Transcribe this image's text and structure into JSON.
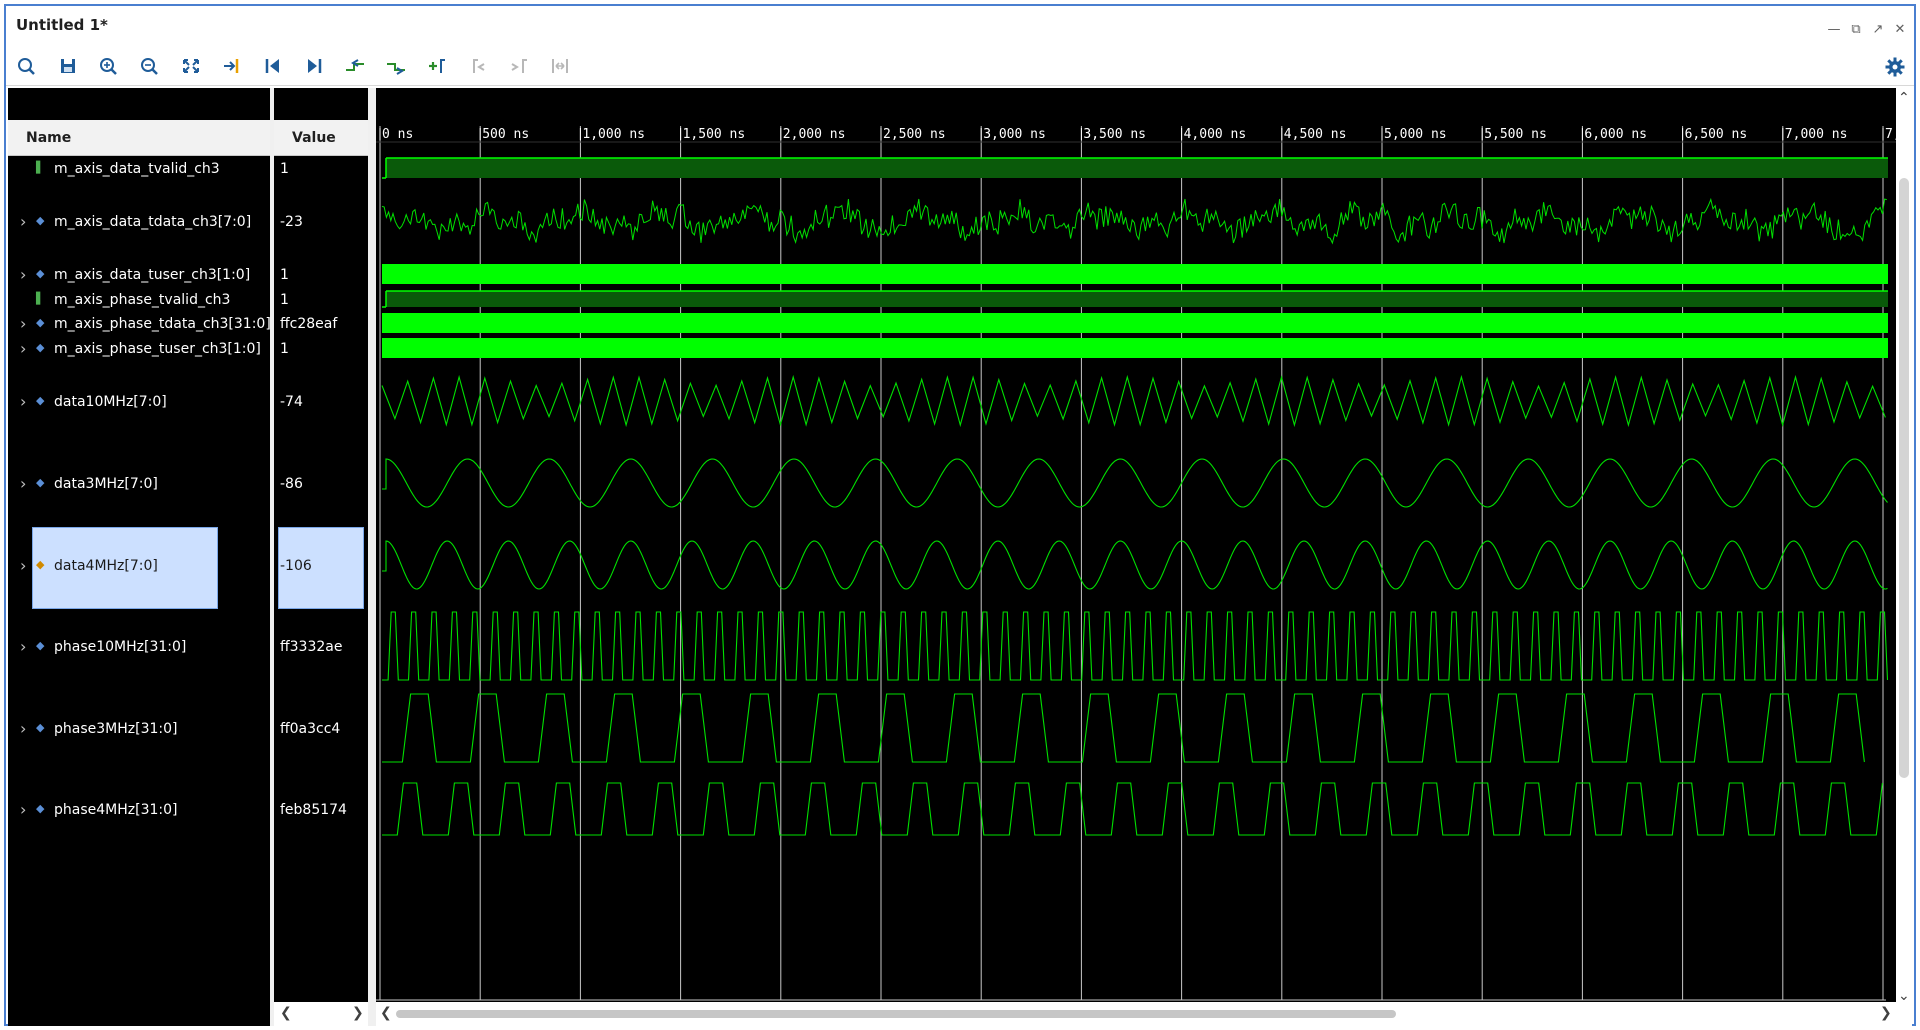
{
  "window": {
    "title": "Untitled 1*"
  },
  "toolbar": {
    "buttons": [
      "search-icon",
      "save-icon",
      "zoom-in-icon",
      "zoom-out-icon",
      "zoom-fit-icon",
      "go-to-cursor-icon",
      "go-to-start-icon",
      "go-to-end-icon",
      "previous-transition-icon",
      "next-transition-icon",
      "add-marker-icon",
      "previous-marker-icon",
      "next-marker-icon",
      "swap-cursors-icon"
    ],
    "settings_icon": "gear-icon"
  },
  "columns": {
    "name_header": "Name",
    "value_header": "Value"
  },
  "timeline": {
    "ticks": [
      "0 ns",
      "500 ns",
      "1,000 ns",
      "1,500 ns",
      "2,000 ns",
      "2,500 ns",
      "3,000 ns",
      "3,500 ns",
      "4,000 ns",
      "4,500 ns",
      "5,000 ns",
      "5,500 ns",
      "6,000 ns",
      "6,500 ns",
      "7,000 ns",
      "7,"
    ]
  },
  "signals": [
    {
      "name": "m_axis_data_tvalid_ch3",
      "value": "1",
      "kind": "bit",
      "expandable": false,
      "wave": "high",
      "selected": false
    },
    {
      "name": "m_axis_data_tdata_ch3[7:0]",
      "value": "-23",
      "kind": "bus",
      "expandable": true,
      "wave": "noise",
      "selected": false
    },
    {
      "name": "m_axis_data_tuser_ch3[1:0]",
      "value": "1",
      "kind": "bus",
      "expandable": true,
      "wave": "dense",
      "selected": false
    },
    {
      "name": "m_axis_phase_tvalid_ch3",
      "value": "1",
      "kind": "bit",
      "expandable": false,
      "wave": "high",
      "selected": false
    },
    {
      "name": "m_axis_phase_tdata_ch3[31:0]",
      "value": "ffc28eaf",
      "kind": "bus",
      "expandable": true,
      "wave": "dense",
      "selected": false
    },
    {
      "name": "m_axis_phase_tuser_ch3[1:0]",
      "value": "1",
      "kind": "bus",
      "expandable": true,
      "wave": "dense",
      "selected": false
    },
    {
      "name": "data10MHz[7:0]",
      "value": "-74",
      "kind": "bus",
      "expandable": true,
      "wave": "sine10",
      "selected": false
    },
    {
      "name": "data3MHz[7:0]",
      "value": "-86",
      "kind": "bus",
      "expandable": true,
      "wave": "sine3",
      "selected": false
    },
    {
      "name": "data4MHz[7:0]",
      "value": "-106",
      "kind": "bus",
      "expandable": true,
      "wave": "sine4",
      "selected": true
    },
    {
      "name": "phase10MHz[31:0]",
      "value": "ff3332ae",
      "kind": "bus",
      "expandable": true,
      "wave": "saw10",
      "selected": false
    },
    {
      "name": "phase3MHz[31:0]",
      "value": "ff0a3cc4",
      "kind": "bus",
      "expandable": true,
      "wave": "saw3",
      "selected": false
    },
    {
      "name": "phase4MHz[31:0]",
      "value": "feb85174",
      "kind": "bus",
      "expandable": true,
      "wave": "saw4",
      "selected": false
    }
  ],
  "colors": {
    "wave": "#00e000",
    "bright": "#00ff00",
    "fill_dark": "#0a5a0a",
    "grid": "#c8c8c8",
    "selection": "#cce0ff"
  }
}
